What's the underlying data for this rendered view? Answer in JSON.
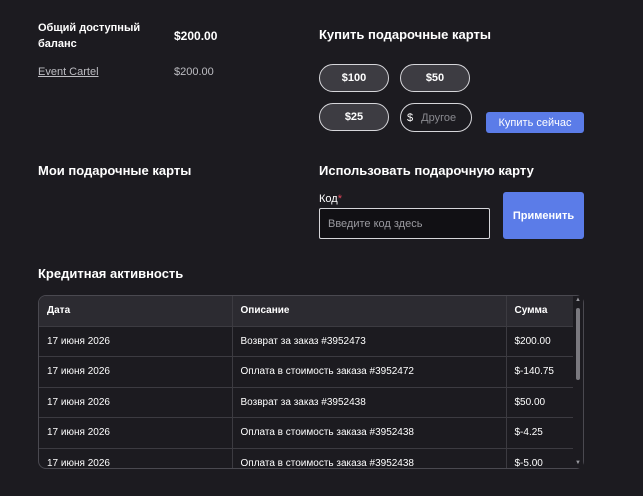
{
  "balance": {
    "label": "Общий доступный баланс",
    "total": "$200.00",
    "merchant": "Event Cartel",
    "merchant_amount": "$200.00"
  },
  "buy": {
    "title": "Купить подарочные карты",
    "amounts": [
      "$100",
      "$50",
      "$25"
    ],
    "currency_symbol": "$",
    "other_placeholder": "Другое",
    "buy_now_label": "Купить сейчас"
  },
  "my_cards": {
    "title": "Мои подарочные карты"
  },
  "redeem": {
    "title": "Использовать подарочную карту",
    "code_label": "Код",
    "required_mark": "*",
    "code_placeholder": "Введите код здесь",
    "apply_label": "Применить"
  },
  "activity": {
    "title": "Кредитная активность",
    "columns": [
      "Дата",
      "Описание",
      "Сумма"
    ],
    "rows": [
      [
        "17 июня 2026",
        "Возврат за заказ #3952473",
        "$200.00"
      ],
      [
        "17 июня 2026",
        "Оплата в стоимость заказа #3952472",
        "$-140.75"
      ],
      [
        "17 июня 2026",
        "Возврат за заказ #3952438",
        "$50.00"
      ],
      [
        "17 июня 2026",
        "Оплата в стоимость заказа #3952438",
        "$-4.25"
      ],
      [
        "17 июня 2026",
        "Оплата в стоимость заказа #3952438",
        "$-5.00"
      ]
    ]
  },
  "icons": {
    "scroll_up": "triangle-up",
    "scroll_down": "triangle-down"
  }
}
